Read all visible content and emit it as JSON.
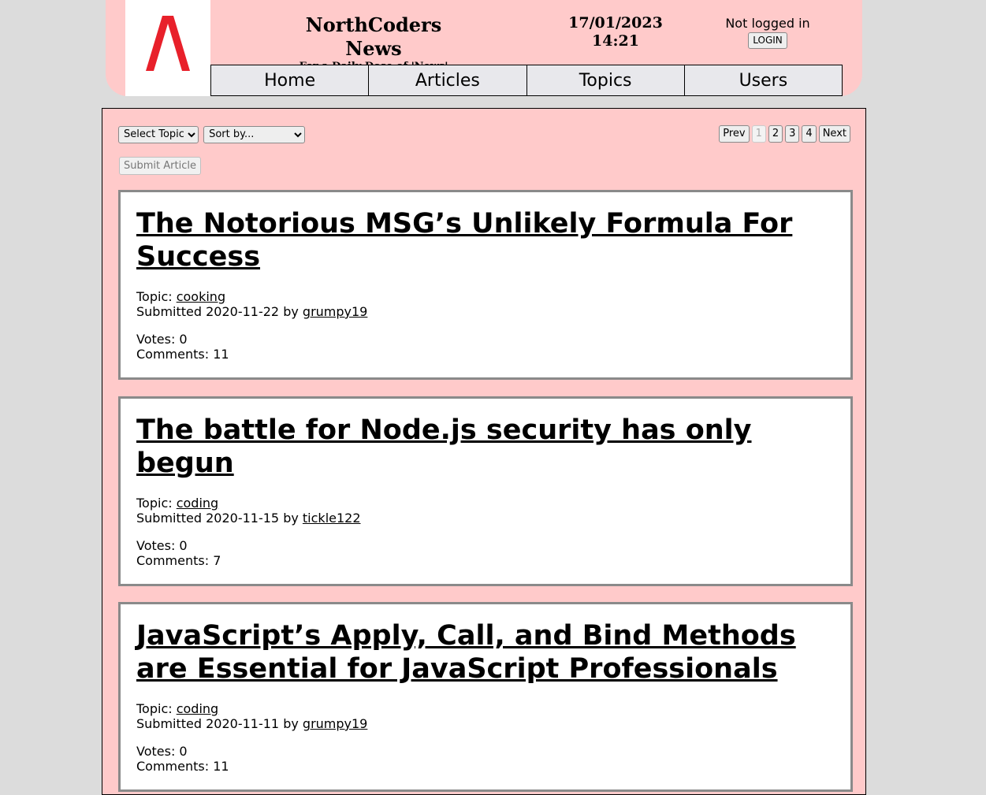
{
  "header": {
    "title": "NorthCoders News",
    "subtitle": "For a Daily Dose of 'News'",
    "date": "17/01/2023",
    "time": "14:21",
    "login_status": "Not logged in",
    "login_label": "LOGIN",
    "logo_color": "#e8202a"
  },
  "nav": {
    "home": "Home",
    "articles": "Articles",
    "topics": "Topics",
    "users": "Users"
  },
  "controls": {
    "topic_select": "Select Topic",
    "sort_select": "Sort by...",
    "submit_label": "Submit Article"
  },
  "pagination": {
    "prev": "Prev",
    "pages": [
      "1",
      "2",
      "3",
      "4"
    ],
    "current": "1",
    "next": "Next"
  },
  "articles": [
    {
      "title": "The Notorious MSG’s Unlikely Formula For Success",
      "topic_label": "Topic: ",
      "topic": "cooking",
      "submitted_prefix": "Submitted 2020-11-22 by ",
      "author": "grumpy19",
      "votes": "Votes: 0",
      "comments": "Comments: 11"
    },
    {
      "title": "The battle for Node.js security has only begun",
      "topic_label": "Topic: ",
      "topic": "coding",
      "submitted_prefix": "Submitted 2020-11-15 by ",
      "author": "tickle122",
      "votes": "Votes: 0",
      "comments": "Comments: 7"
    },
    {
      "title": "JavaScript’s Apply, Call, and Bind Methods are Essential for JavaScript Professionals",
      "topic_label": "Topic: ",
      "topic": "coding",
      "submitted_prefix": "Submitted 2020-11-11 by ",
      "author": "grumpy19",
      "votes": "Votes: 0",
      "comments": "Comments: 11"
    }
  ]
}
